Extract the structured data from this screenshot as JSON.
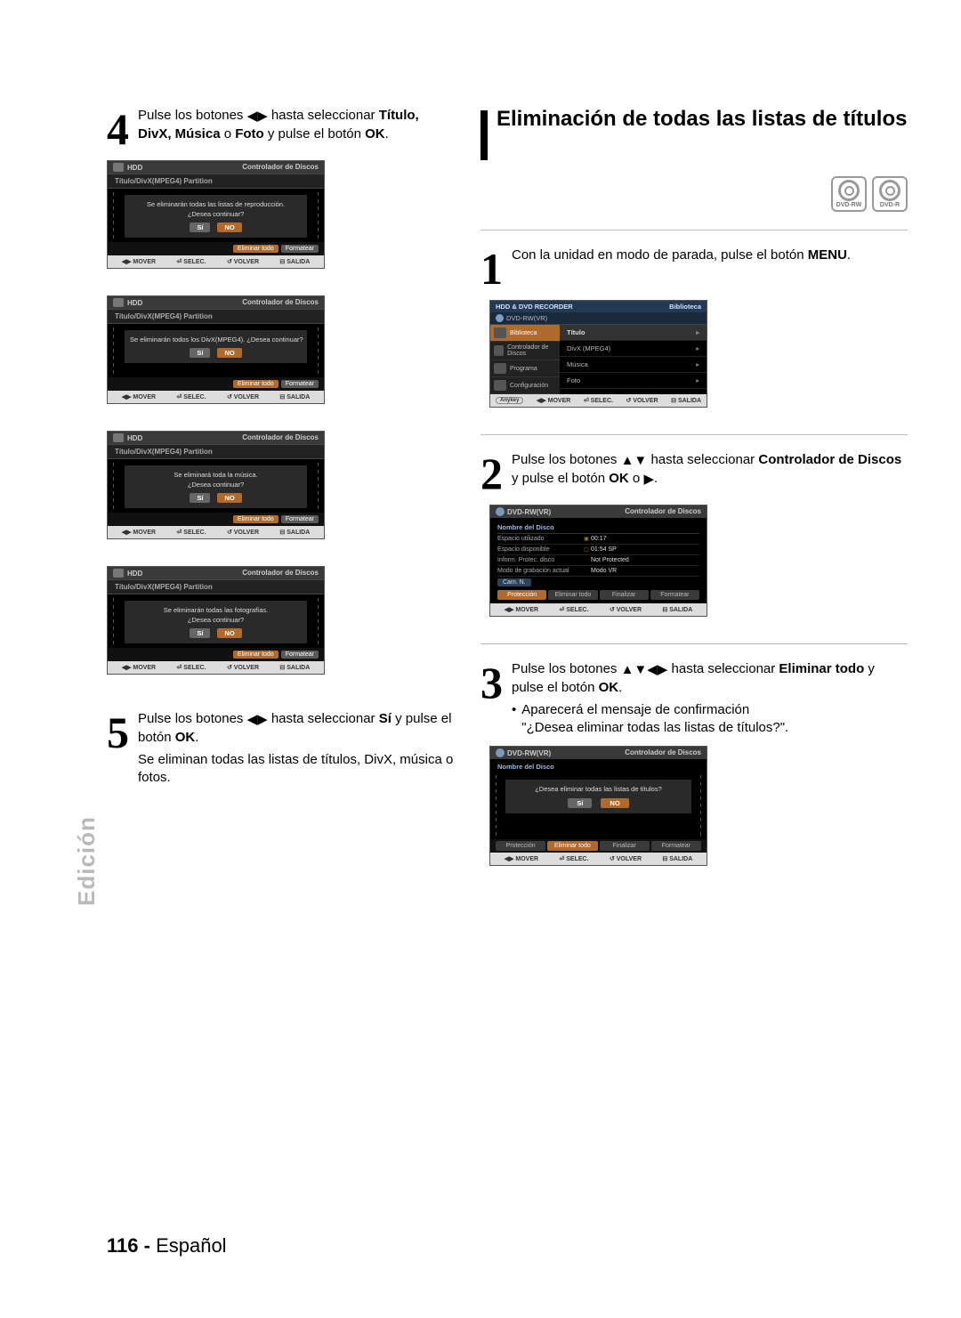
{
  "section_tab": "Edición",
  "page_footer_num": "116 -",
  "page_footer_lang": "Español",
  "left": {
    "step4": {
      "num": "4",
      "text_pre": "Pulse los botones ",
      "text_mid": " hasta seleccionar ",
      "bold1": "Título, DivX, Música",
      "joiner": " o ",
      "bold2": "Foto",
      "text_post": " y pulse el botón ",
      "bold3": "OK",
      "dot": "."
    },
    "screensA": [
      {
        "msg1": "Se eliminarán todas las listas de reproducción.",
        "msg2": "¿Desea continuar?"
      },
      {
        "msg1": "Se eliminarán todos los DivX(MPEG4). ¿Desea continuar?",
        "msg2": ""
      },
      {
        "msg1": "Se eliminará toda la música.",
        "msg2": "¿Desea continuar?"
      },
      {
        "msg1": "Se eliminarán todas las fotografías.",
        "msg2": "¿Desea continuar?"
      }
    ],
    "scrA_header_left": "HDD",
    "scrA_header_right": "Controlador de Discos",
    "scrA_sub": "Título/DivX(MPEG4) Partition",
    "scrA_btn_si": "Sí",
    "scrA_btn_no": "NO",
    "scrA_chip_e": "Eliminar todo",
    "scrA_chip_f": "Formatear",
    "footer_keys": {
      "mover": "MOVER",
      "selec": "SELEC.",
      "volver": "VOLVER",
      "salida": "SALIDA"
    },
    "step5": {
      "num": "5",
      "text_pre": "Pulse los botones ",
      "text_mid": " hasta seleccionar ",
      "bold1": "Sí",
      "text_post": " y pulse el botón ",
      "bold2": "OK",
      "dot": ".",
      "para2": "Se eliminan todas las listas de títulos, DivX, música o fotos."
    }
  },
  "right": {
    "title": "Eliminación de todas las listas de títulos",
    "discs": [
      "DVD-RW",
      "DVD-R"
    ],
    "step1": {
      "num": "1",
      "text": "Con la unidad en modo de parada, pulse el botón ",
      "bold": "MENU",
      "dot": "."
    },
    "scrB": {
      "top_left": "HDD & DVD RECORDER",
      "top_right": "Biblioteca",
      "sub": "DVD-RW(VR)",
      "side": [
        {
          "label": "Biblioteca",
          "sel": true
        },
        {
          "label": "Controlador de Discos",
          "sel": false
        },
        {
          "label": "Programa",
          "sel": false
        },
        {
          "label": "Configuración",
          "sel": false
        }
      ],
      "rows": [
        {
          "label": "Título",
          "head": true
        },
        {
          "label": "DivX (MPEG4)"
        },
        {
          "label": "Música"
        },
        {
          "label": "Foto"
        }
      ],
      "anykey": "Anykey"
    },
    "step2": {
      "num": "2",
      "text_pre": "Pulse los botones ",
      "text_mid": " hasta seleccionar ",
      "bold1": "Controlador de Discos",
      "text_post": " y pulse el botón ",
      "bold2": "OK",
      "joiner": " o ",
      "dot": "."
    },
    "scrC": {
      "hdr_left": "DVD-RW(VR)",
      "hdr_right": "Controlador de Discos",
      "title": "Nombre del Disco",
      "info": [
        {
          "k": "Espacio utilizado",
          "ic": "▣",
          "v": "00:17"
        },
        {
          "k": "Espacio disponible",
          "ic": "▢",
          "v": "01:54 SP"
        },
        {
          "k": "Inform. Protec. disco",
          "ic": "",
          "v": "Not Protected"
        },
        {
          "k": "Modo de grabación actual",
          "ic": "",
          "v": "Modo VR"
        }
      ],
      "cam": "Cam. N.",
      "tabs": [
        "Protección",
        "Eliminar todo",
        "Finalizar",
        "Formatear"
      ]
    },
    "step3": {
      "num": "3",
      "text_pre": "Pulse los botones ",
      "text_mid": " hasta seleccionar ",
      "bold1": "Eliminar todo",
      "text_post": " y pulse el botón ",
      "bold2": "OK",
      "dot": ".",
      "bullet1": "Aparecerá el mensaje de confirmación",
      "bullet2": "\"¿Desea eliminar todas las listas de títulos?\"."
    },
    "scrD": {
      "hdr_left": "DVD-RW(VR)",
      "hdr_right": "Controlador de Discos",
      "title": "Nombre del Disco",
      "msg": "¿Desea eliminar todas las listas de títulos?",
      "si": "Sí",
      "no": "NO",
      "tabs": [
        "Protección",
        "Eliminar todo",
        "Finalizar",
        "Formatear"
      ]
    }
  }
}
